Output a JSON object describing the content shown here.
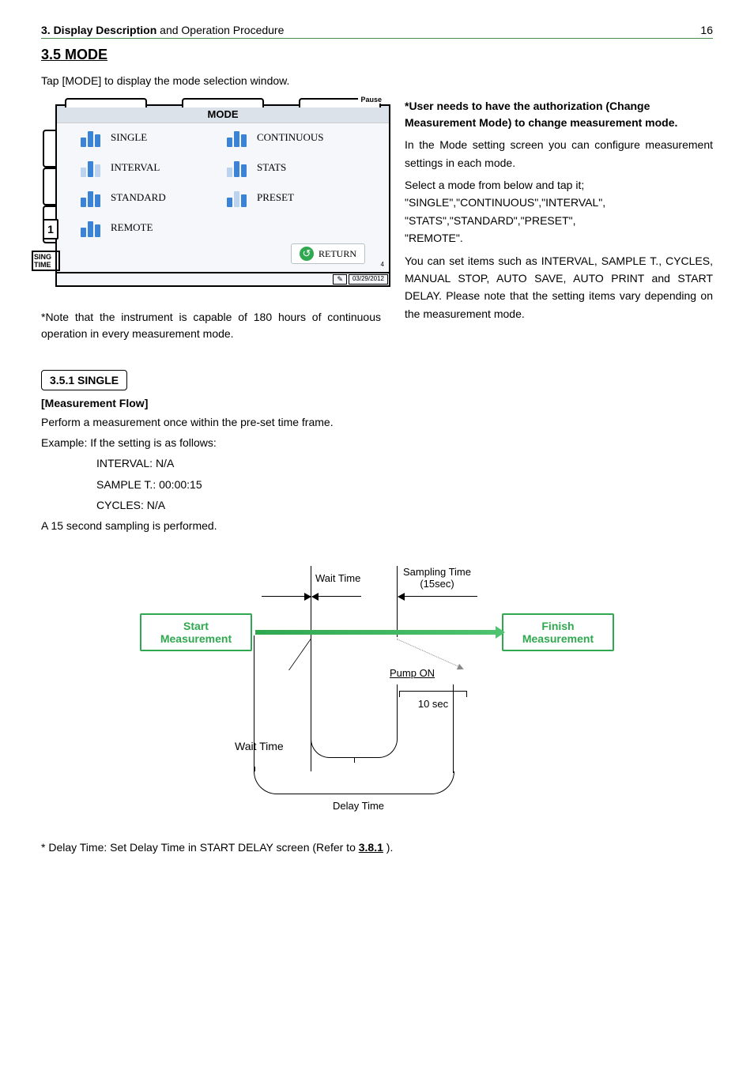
{
  "header": {
    "title_bold": "3. Display Description",
    "title_rest": " and Operation Procedure",
    "page": "16"
  },
  "section": {
    "num_title": "3.5 MODE",
    "intro": "Tap [MODE] to display the mode selection window."
  },
  "mode_window": {
    "pause": "Pause",
    "title": "MODE",
    "items": {
      "single": "SINGLE",
      "continuous": "CONTINUOUS",
      "interval": "INTERVAL",
      "stats": "STATS",
      "standard": "STANDARD",
      "preset": "PRESET",
      "remote": "REMOTE"
    },
    "return": "RETURN",
    "one": "1",
    "sing": "SING",
    "time": "TIME",
    "four": "4",
    "pen": "✎",
    "date": "03/29/2012"
  },
  "left_note": "*Note that the instrument is capable of 180 hours of continuous operation in every measurement mode.",
  "right": {
    "bold1": "*User needs to have the authorization (Change Measurement Mode) to change measurement mode.",
    "p1": "In the Mode setting screen you can configure measurement settings in each mode.",
    "p2a": "Select a mode from below and tap it;",
    "p2b": "\"SINGLE\",\"CONTINUOUS\",\"INTERVAL\",",
    "p2c": "\"STATS\",\"STANDARD\",\"PRESET\",",
    "p2d": "\"REMOTE\".",
    "p3": "You can set items such as INTERVAL, SAMPLE T., CYCLES, MANUAL STOP, AUTO SAVE, AUTO PRINT and START DELAY. Please note that the setting items vary depending on the measurement mode."
  },
  "single": {
    "box": "3.5.1 SINGLE",
    "flow_h": "[Measurement Flow]",
    "l1": "Perform a measurement once within the pre-set time frame.",
    "l2": "Example: If the setting is as follows:",
    "l3": "INTERVAL: N/A",
    "l4": "SAMPLE T.: 00:00:15",
    "l5": "CYCLES: N/A",
    "l6": "A 15 second sampling is performed."
  },
  "diagram": {
    "start": "Start Measurement",
    "finish": "Finish Measurement",
    "wait": "Wait Time",
    "sampling": "Sampling Time",
    "sampling_sub": "(15sec)",
    "pump": "Pump ON",
    "ten": "10 sec",
    "wait2": "Wait Time",
    "delay": "Delay Time"
  },
  "footnote": {
    "pre": "* Delay Time: Set Delay Time in START DELAY screen (Refer to ",
    "link": "3.8.1",
    "post": " )."
  }
}
